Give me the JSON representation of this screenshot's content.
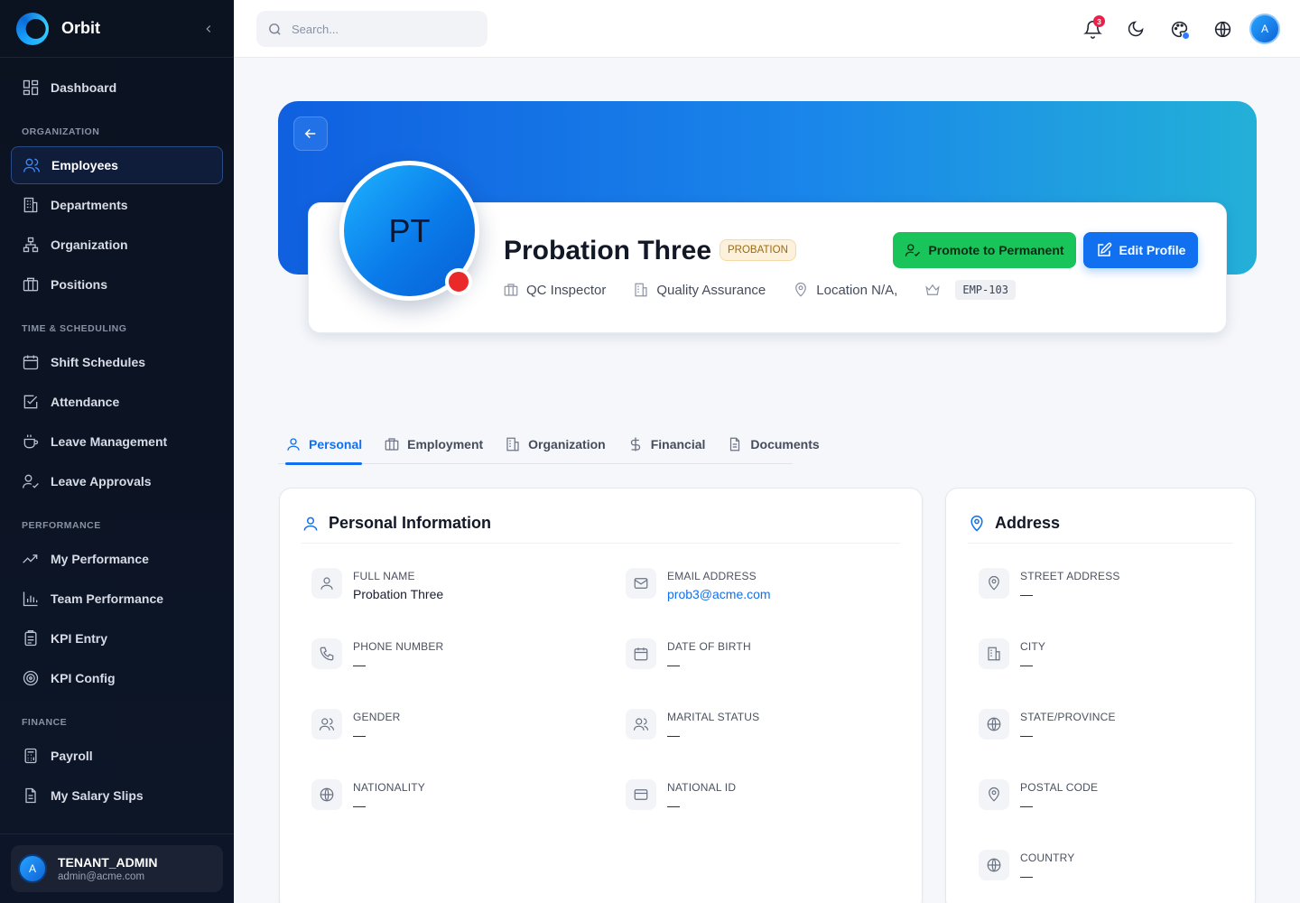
{
  "app": {
    "name": "Orbit"
  },
  "sidebar": {
    "dashboard": "Dashboard",
    "sections": {
      "organization": "ORGANIZATION",
      "time": "TIME & SCHEDULING",
      "performance": "PERFORMANCE",
      "finance": "FINANCE"
    },
    "items": {
      "employees": "Employees",
      "departments": "Departments",
      "organization": "Organization",
      "positions": "Positions",
      "shift_schedules": "Shift Schedules",
      "attendance": "Attendance",
      "leave_management": "Leave Management",
      "leave_approvals": "Leave Approvals",
      "my_performance": "My Performance",
      "team_performance": "Team Performance",
      "kpi_entry": "KPI Entry",
      "kpi_config": "KPI Config",
      "payroll": "Payroll",
      "my_salary_slips": "My Salary Slips"
    },
    "user": {
      "initial": "A",
      "role": "TENANT_ADMIN",
      "email": "admin@acme.com"
    }
  },
  "topbar": {
    "search_placeholder": "Search...",
    "notification_count": "3",
    "avatar_initial": "A"
  },
  "profile": {
    "initials": "PT",
    "name": "Probation Three",
    "status": "PROBATION",
    "position": "QC Inspector",
    "department": "Quality Assurance",
    "location": "Location N/A,",
    "employee_id": "EMP-103",
    "promote_label": "Promote to Permanent",
    "edit_label": "Edit Profile"
  },
  "tabs": [
    "Personal",
    "Employment",
    "Organization",
    "Financial",
    "Documents"
  ],
  "personal": {
    "title": "Personal Information",
    "fields": {
      "full_name": {
        "label": "FULL NAME",
        "value": "Probation Three"
      },
      "email": {
        "label": "EMAIL ADDRESS",
        "value": "prob3@acme.com"
      },
      "phone": {
        "label": "PHONE NUMBER",
        "value": "—"
      },
      "dob": {
        "label": "DATE OF BIRTH",
        "value": "—"
      },
      "gender": {
        "label": "GENDER",
        "value": "—"
      },
      "marital": {
        "label": "MARITAL STATUS",
        "value": "—"
      },
      "nationality": {
        "label": "NATIONALITY",
        "value": "—"
      },
      "national_id": {
        "label": "NATIONAL ID",
        "value": "—"
      }
    }
  },
  "address": {
    "title": "Address",
    "fields": {
      "street": {
        "label": "STREET ADDRESS",
        "value": "—"
      },
      "city": {
        "label": "CITY",
        "value": "—"
      },
      "state": {
        "label": "STATE/PROVINCE",
        "value": "—"
      },
      "postal": {
        "label": "POSTAL CODE",
        "value": "—"
      },
      "country": {
        "label": "COUNTRY",
        "value": "—"
      }
    }
  },
  "colors": {
    "accent": "#1170f0",
    "promote": "#19c45a",
    "probation_badge": "#fdf1dc",
    "status_dot": "#ea2a2a"
  }
}
